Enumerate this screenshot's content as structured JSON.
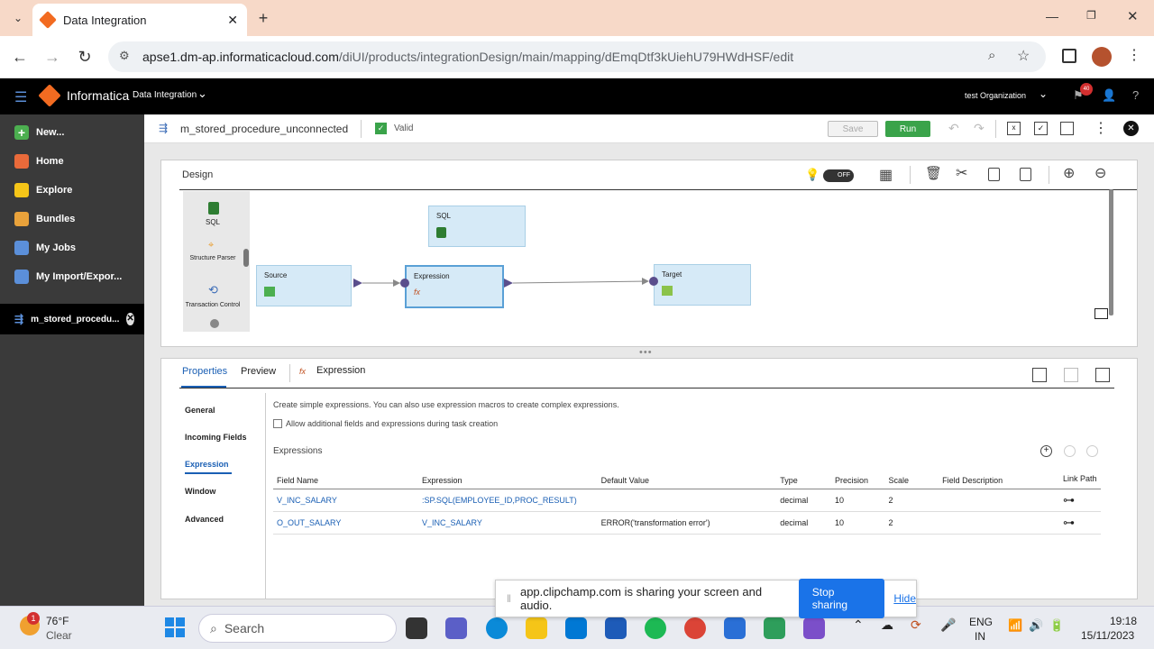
{
  "browser": {
    "tab_title": "Data Integration",
    "url_host": "apse1.dm-ap.informaticacloud.com",
    "url_path": "/diUI/products/integrationDesign/main/mapping/dEmqDtf3kUiehU79HWdHSF/edit"
  },
  "app": {
    "brand": "Informatica",
    "product": "Data Integration",
    "org": "test Organization",
    "notification_count": "40"
  },
  "sidebar": {
    "items": [
      {
        "label": "New...",
        "icon": "plus-icon",
        "color": "#4caf50"
      },
      {
        "label": "Home",
        "icon": "home-icon",
        "color": "#e96a3a"
      },
      {
        "label": "Explore",
        "icon": "folder-icon",
        "color": "#f5c518"
      },
      {
        "label": "Bundles",
        "icon": "bundles-icon",
        "color": "#e9a23b"
      },
      {
        "label": "My Jobs",
        "icon": "jobs-icon",
        "color": "#5b8fd9"
      },
      {
        "label": "My Import/Expor...",
        "icon": "import-icon",
        "color": "#5b8fd9"
      }
    ],
    "open_asset": "m_stored_procedu..."
  },
  "toolbar": {
    "mapping_name": "m_stored_procedure_unconnected",
    "status": "Valid",
    "save_label": "Save",
    "run_label": "Run"
  },
  "design": {
    "title": "Design",
    "toggle_label": "OFF",
    "palette": [
      {
        "label": "SQL"
      },
      {
        "label": "Structure Parser"
      },
      {
        "label": "Transaction Control"
      }
    ],
    "nodes": {
      "sql": "SQL",
      "source": "Source",
      "expression": "Expression",
      "target": "Target"
    }
  },
  "properties": {
    "tabs": [
      "Properties",
      "Preview"
    ],
    "object_name": "Expression",
    "nav": [
      "General",
      "Incoming Fields",
      "Expression",
      "Window",
      "Advanced"
    ],
    "active_nav": "Expression",
    "description": "Create simple expressions. You can also use expression macros to create complex expressions.",
    "checkbox_label": "Allow additional fields and expressions during task creation",
    "section_title": "Expressions",
    "columns": [
      "Field Name",
      "Expression",
      "Default Value",
      "Type",
      "Precision",
      "Scale",
      "Field Description",
      "Link Path"
    ],
    "rows": [
      {
        "field": "V_INC_SALARY",
        "expression": ":SP.SQL(EMPLOYEE_ID,PROC_RESULT)",
        "default": "",
        "type": "decimal",
        "precision": "10",
        "scale": "2",
        "desc": ""
      },
      {
        "field": "O_OUT_SALARY",
        "expression": "V_INC_SALARY",
        "default": "ERROR('transformation error')",
        "type": "decimal",
        "precision": "10",
        "scale": "2",
        "desc": ""
      }
    ]
  },
  "share_bar": {
    "message": "app.clipchamp.com is sharing your screen and audio.",
    "stop_label": "Stop sharing",
    "hide_label": "Hide"
  },
  "taskbar": {
    "weather_temp": "76°F",
    "weather_desc": "Clear",
    "weather_badge": "1",
    "search_placeholder": "Search",
    "lang": "ENG",
    "region": "IN",
    "time": "19:18",
    "date": "15/11/2023"
  }
}
